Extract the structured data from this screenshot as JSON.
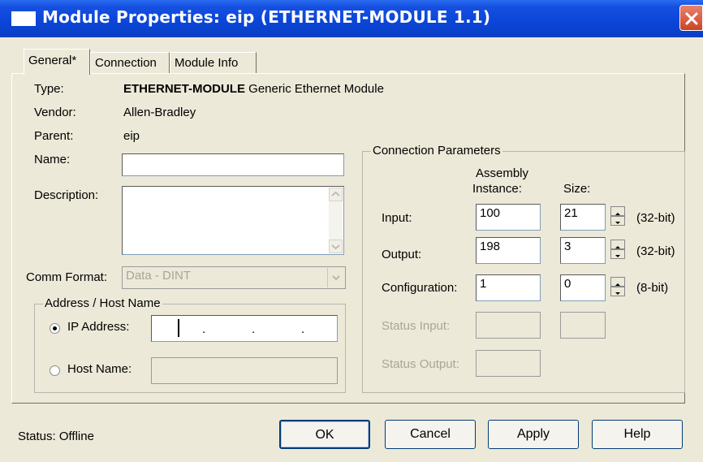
{
  "window": {
    "title": "Module Properties: eip (ETHERNET-MODULE 1.1)"
  },
  "tabs": [
    {
      "label": "General*"
    },
    {
      "label": "Connection"
    },
    {
      "label": "Module Info"
    }
  ],
  "general": {
    "type_label": "Type:",
    "type_value_bold": "ETHERNET-MODULE",
    "type_value_rest": "Generic Ethernet Module",
    "vendor_label": "Vendor:",
    "vendor_value": "Allen-Bradley",
    "parent_label": "Parent:",
    "parent_value": "eip",
    "name_label": "Name:",
    "name_value": "",
    "description_label": "Description:",
    "description_value": "",
    "comm_format_label": "Comm Format:",
    "comm_format_value": "Data - DINT"
  },
  "address": {
    "group_title": "Address / Host Name",
    "ip_label": "IP Address:",
    "ip_value": ".     .     .",
    "ip_selected": true,
    "host_label": "Host Name:",
    "host_value": ""
  },
  "connection_params": {
    "group_title": "Connection Parameters",
    "col_assembly_line1": "Assembly",
    "col_assembly_line2": "Instance:",
    "col_size": "Size:",
    "rows": [
      {
        "label": "Input:",
        "instance": "100",
        "size": "21",
        "unit": "(32-bit)"
      },
      {
        "label": "Output:",
        "instance": "198",
        "size": "3",
        "unit": "(32-bit)"
      },
      {
        "label": "Configuration:",
        "instance": "1",
        "size": "0",
        "unit": "(8-bit)"
      },
      {
        "label": "Status Input:",
        "instance": "",
        "size": ""
      },
      {
        "label": "Status Output:",
        "instance": ""
      }
    ]
  },
  "status": {
    "text": "Status:  Offline"
  },
  "buttons": {
    "ok": "OK",
    "cancel": "Cancel",
    "apply": "Apply",
    "help": "Help"
  }
}
